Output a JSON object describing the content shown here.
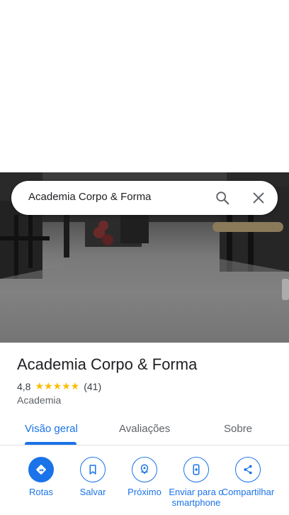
{
  "search": {
    "query": "Academia Corpo & Forma"
  },
  "place": {
    "title": "Academia Corpo & Forma",
    "rating": "4,8",
    "stars": "★★★★★",
    "review_count": "(41)",
    "category": "Academia"
  },
  "tabs": [
    {
      "label": "Visão geral",
      "active": true
    },
    {
      "label": "Avaliações",
      "active": false
    },
    {
      "label": "Sobre",
      "active": false
    }
  ],
  "actions": [
    {
      "label": "Rotas",
      "icon": "directions-icon"
    },
    {
      "label": "Salvar",
      "icon": "bookmark-icon"
    },
    {
      "label": "Próximo",
      "icon": "nearby-icon"
    },
    {
      "label": "Enviar para o smartphone",
      "icon": "send-to-phone-icon"
    },
    {
      "label": "Compartilhar",
      "icon": "share-icon"
    }
  ],
  "colors": {
    "accent": "#1a73e8",
    "star": "#fbbc04"
  }
}
